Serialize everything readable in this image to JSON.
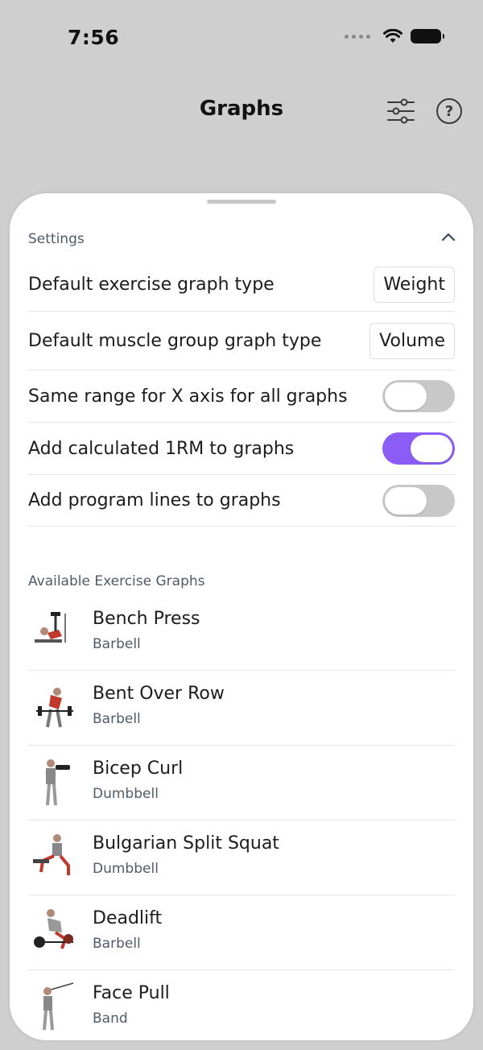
{
  "status_bar": {
    "time": "7:56"
  },
  "header": {
    "title": "Graphs",
    "filter_icon": "sliders-icon",
    "help_icon": "question-circle-icon",
    "help_glyph": "?"
  },
  "settings": {
    "title": "Settings",
    "collapse_icon": "chevron-up-icon",
    "default_exercise_graph": {
      "label": "Default exercise graph type",
      "value": "Weight"
    },
    "default_muscle_graph": {
      "label": "Default muscle group graph type",
      "value": "Volume"
    },
    "same_range": {
      "label": "Same range for X axis for all graphs",
      "on": false
    },
    "calc_1rm": {
      "label": "Add calculated 1RM to graphs",
      "on": true
    },
    "program_lines": {
      "label": "Add program lines to graphs",
      "on": false
    }
  },
  "exercises": {
    "title": "Available Exercise Graphs",
    "items": [
      {
        "name": "Bench Press",
        "equipment": "Barbell"
      },
      {
        "name": "Bent Over Row",
        "equipment": "Barbell"
      },
      {
        "name": "Bicep Curl",
        "equipment": "Dumbbell"
      },
      {
        "name": "Bulgarian Split Squat",
        "equipment": "Dumbbell"
      },
      {
        "name": "Deadlift",
        "equipment": "Barbell"
      },
      {
        "name": "Face Pull",
        "equipment": "Band"
      }
    ]
  },
  "colors": {
    "accent": "#8b5cf6",
    "toggle_off": "#c8c8c8",
    "muted_text": "#4e5b6b"
  }
}
